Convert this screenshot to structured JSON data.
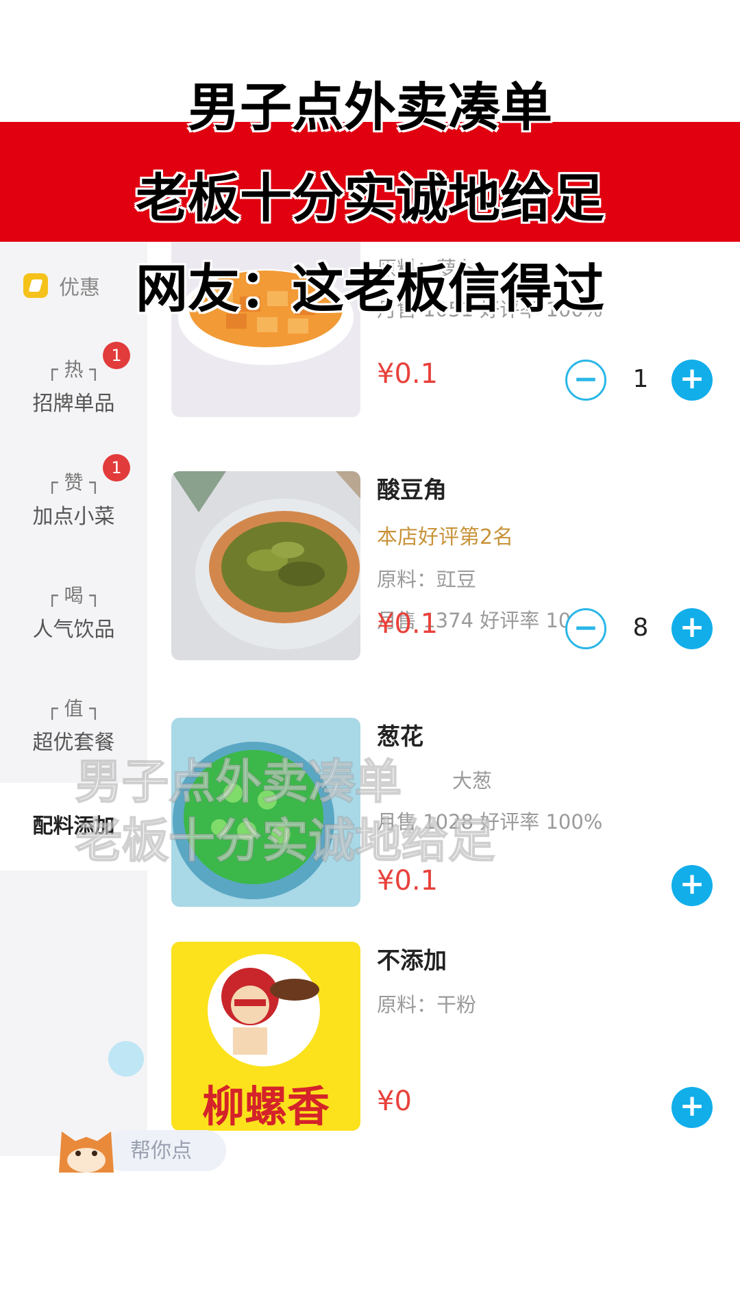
{
  "headlines": {
    "line1": "男子点外卖凑单",
    "line2": "老板十分实诚地给足",
    "line3": "网友：这老板信得过"
  },
  "overlay_caption": {
    "line1": "男子点外卖凑单",
    "line2": "老板十分实诚地给足"
  },
  "colors": {
    "band": "#e1000f",
    "price": "#e8413b",
    "accent": "#11aeea",
    "badge": "#e23b3b"
  },
  "sidebar": {
    "promo": "优惠",
    "items": [
      {
        "tag": "┌ 热 ┐",
        "name": "招牌单品",
        "badge": "1"
      },
      {
        "tag": "┌ 赞 ┐",
        "name": "加点小菜",
        "badge": "1"
      },
      {
        "tag": "┌ 喝 ┐",
        "name": "人气饮品",
        "badge": ""
      },
      {
        "tag": "┌ 值 ┐",
        "name": "超优套餐",
        "badge": ""
      },
      {
        "tag": "",
        "name": "配料添加",
        "badge": ""
      }
    ]
  },
  "products": [
    {
      "name": "",
      "rank": "",
      "material": "原料：萝卜",
      "sales": "月售 1051 好评率 100%",
      "price": "¥0.1",
      "qty": "1",
      "image": "carrot-dish"
    },
    {
      "name": "酸豆角",
      "rank": "本店好评第2名",
      "material": "原料：豇豆",
      "sales": "月售 1374 好评率 100%",
      "price": "¥0.1",
      "qty": "8",
      "image": "sour-beans-dish"
    },
    {
      "name": "葱花",
      "rank": "",
      "material": "大葱",
      "sales": "月售 1028 好评率 100%",
      "price": "¥0.1",
      "qty": "",
      "image": "scallion-bowl"
    },
    {
      "name": "不添加",
      "rank": "",
      "material": "原料：干粉",
      "sales": "",
      "price": "¥0",
      "qty": "",
      "image": "liuluoxiang-logo"
    }
  ],
  "logo_text": "柳螺香",
  "helper": {
    "text": "帮你点"
  }
}
